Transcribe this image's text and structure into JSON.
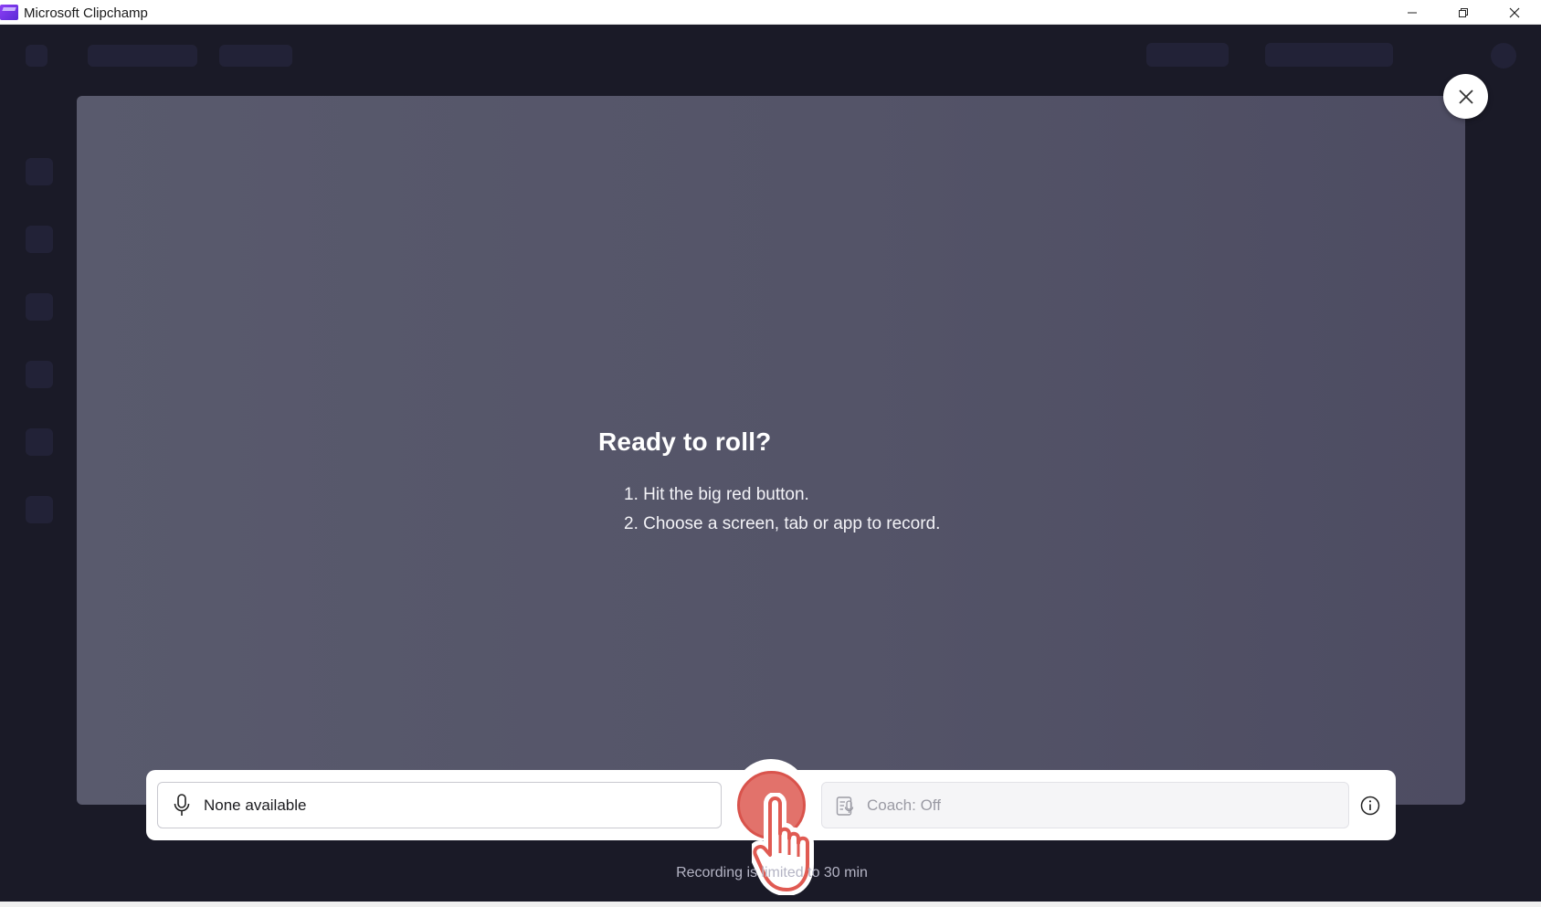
{
  "window": {
    "title": "Microsoft Clipchamp",
    "controls": {
      "minimize_icon": "minimize-icon",
      "maximize_icon": "restore-icon",
      "close_icon": "close-icon"
    }
  },
  "recorder": {
    "heading": "Ready to roll?",
    "steps": [
      "1. Hit the big red button.",
      "2. Choose a screen, tab or app to record."
    ],
    "microphone": {
      "value": "None available",
      "icon": "microphone-icon"
    },
    "coach": {
      "value": "Coach: Off",
      "icon": "speaker-coach-icon",
      "enabled": false
    },
    "record_button_color": "#e2726b",
    "limit_note": "Recording is limited to 30 min"
  },
  "colors": {
    "app_background": "#1a1a27",
    "preview_background": "#555569",
    "accent_record": "#e2726b"
  }
}
